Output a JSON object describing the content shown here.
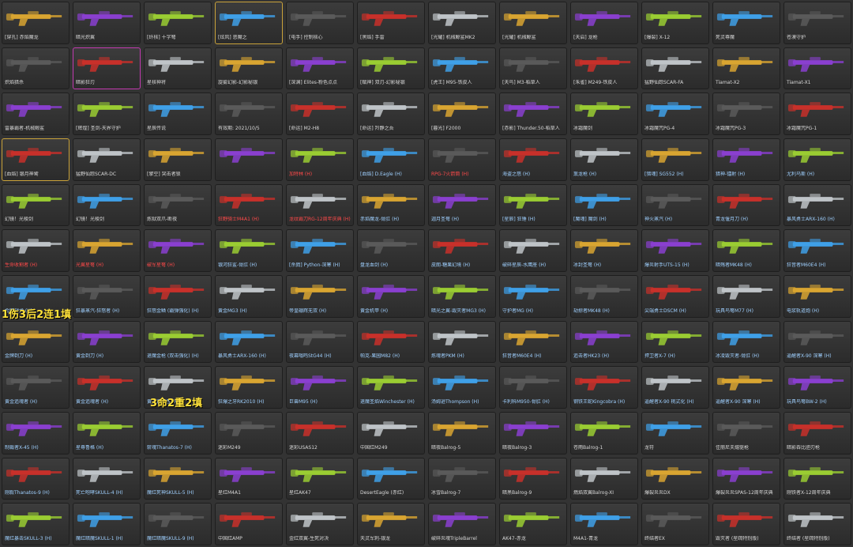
{
  "rows": [
    [
      "[穿孔] 赤焰魔龙",
      "暗光炽翼",
      "[纤核] 十字弩",
      "[炫风] 恶魔之",
      "[电手] 控制核心",
      "[黑焰] 手雷",
      "[光耀] 机械鲸鲨MK2",
      "[光耀] 机械鲸鲨",
      "[天启] 龙枪",
      "[爆裂] X-12",
      "死灵尊魔",
      "苍漠守护"
    ],
    [
      "炽焰猎杀",
      "暗影狂刃",
      "星核神将",
      "旋雾幻影-幻影秘银",
      "[深渊] Elites-粉色点点",
      "[赋神] 双刃-幻影秘银",
      "[虎王] M95-铁皮人",
      "[天鸟] M3-稻草人",
      "[朱雀] M249-铁皮人",
      "猛野仙踪SCAR-FA",
      "Tiamat-X2",
      "Tiamat-X1"
    ],
    [
      "雷暴霸者-机械鲸鲨",
      "[辉煌] 圣剑-天界守护",
      "星辰传说",
      "有效期: 2021/10/5",
      "[命运] M2-H8",
      "[命运] 羚静之吾",
      "[暮光] F2000",
      "[赤影] Thunder.50-稻草人",
      "冰霜魔剑",
      "冰霜魔咒PG-4",
      "冰霜魔咒PG-3",
      "冰霜魔咒PG-1"
    ],
    [
      "[血焰] 银月神鹫",
      "猛野仙踪SCAR-DC",
      "[擎空] 突击者锁",
      "",
      "加特林 (H)",
      "[血焰] D.Eagle (H)",
      "RPG-7火箭筒 (H)",
      "海盗之怒 (H)",
      "熏龙枪 (H)",
      "[猎魂] SG552 (H)",
      "猎神-镭射 (H)",
      "尤利乌斯 (H)",
      "爆炎蒸汽 (H)"
    ],
    [
      "幻镜！光棱剑",
      "幻镜！光棱剑",
      "炼狱双爪-断夜",
      "狂野骑士M4A1 (H)",
      "龙纹霸刀RG-12周年庆典 (H)",
      "赤焰魔龙-骨肛 (H)",
      "迦月圣弩 (H)",
      "[星辰] 狂锤 (H)",
      "[魔魂] 魔剑 (H)",
      "神火蒸汽 (H)",
      "青龙偃月刀 (H)",
      "暴风勇士ARX-160 (H)"
    ],
    [
      "生命收割者 (H)",
      "光翼星弩 (H)",
      "破军星弩 (H)",
      "银河狂鲨-骨肛 (H)",
      "[杀戮] Python-深寒 (H)",
      "盘龙血剑 (H)",
      "皮朗-糖果幻境 (H)",
      "破碎星辰-水鹰座 (H)",
      "冰封圣弩 (H)",
      "爆炎射手UTS-15 (H)",
      "暗殇者MK48 (H)",
      "狂音者M60E4 (H)"
    ],
    [
      "金牌战犬 (H)",
      "狂暴蒸汽-狂怒者 (H)",
      "狂怒金鳞 (霸弹强化) (H)",
      "黄金MG3 (H)",
      "帝皇硼辉无双 (H)",
      "黄金机甲 (H)",
      "暗光之翼-毁灭者MG3 (H)",
      "守护者MG (H)",
      "劫掠者MK48 (H)",
      "尖端勇士DSCM (H)",
      "玩具鸟弩M77 (H)",
      "电浆轨道炮 (H)"
    ],
    [
      "金牌剃刀 (H)",
      "黄金剃刀 (H)",
      "退魔金枪 (双击强化) (H)",
      "暴风勇士ARX-160 (H)",
      "夜幕嗡鸣StG44 (H)",
      "帕克-果园M82 (H)",
      "炼魂者PKM (H)",
      "狂音者M60E4 (H)",
      "追击者HK23 (H)",
      "捍卫者X-7 (H)",
      "冰凌毁灭者-骨肛 (H)",
      "逼醒者X-90 深寒 (H)"
    ],
    [
      "黄金追魂者 (H)",
      "黄金追魂者 (H)",
      "黄金追魂者 (H)",
      "狂爆之牙RK2010 (H)",
      "巨兽M95 (H)",
      "退魔圣焰Winchester (H)",
      "汤姆逊Thompson (H)",
      "卡利科M950-骨肛 (H)",
      "钢铁王蛇Kingcobra (H)",
      "逼醒者X-90 桃式化 (H)",
      "逼醒者X-90 深寒 (H)",
      "玩具鸟弩BW-2 (H)"
    ],
    [
      "制裁者X-45 (H)",
      "星尊鲁格 (H)",
      "斩魂Thanatos-7 (H)",
      "迷彩M249",
      "迷彩USAS12",
      "中国红M249",
      "暗夜Balrog-5",
      "暗夜Balrog-3",
      "苍雨Balrog-1",
      "龙符",
      "佳丽尼夫燧驱枪",
      "暗影吞比胆刃枪"
    ],
    [
      "刚毅Thanatos-9 (H)",
      "死亡咆哮SKULL-4 (H)",
      "魔红死神SKULL-5 (H)",
      "星红M4A1",
      "星红AK47",
      "DesertEagle (赤红)",
      "冰雪Balrog-7",
      "暗黑Balrog-9",
      "燃焰双翼Balrog-XI",
      "爆裂炎炎DX",
      "爆裂炎炎SPAS-12周年庆典",
      "刚铁者X-12周年庆典"
    ],
    [
      "魔红暴击SKULL-3 (H)",
      "魔红暗魔SKULL-1 (H)",
      "魔红暗魔SKULL-9 (H)",
      "中国红AMP",
      "金红双翼-生死对决",
      "天灵军刺-银龙",
      "破碎炎魂TripleBarrel",
      "AK47-赤龙",
      "M4A1-青龙",
      "终结者EX",
      "毁灭者 (星疏特别版)",
      "终结者 (星疏特别版)"
    ]
  ],
  "overlays": {
    "left": "1伤3后2连1填",
    "right": "3命2重2填"
  },
  "colors": {
    "gold": "#d9a531",
    "red": "#c8302a",
    "blue": "#3fa0e8",
    "purple": "#8a3fd0",
    "silver": "#bfc4c8",
    "dark": "#5a5a5a",
    "green": "#9acd32"
  }
}
